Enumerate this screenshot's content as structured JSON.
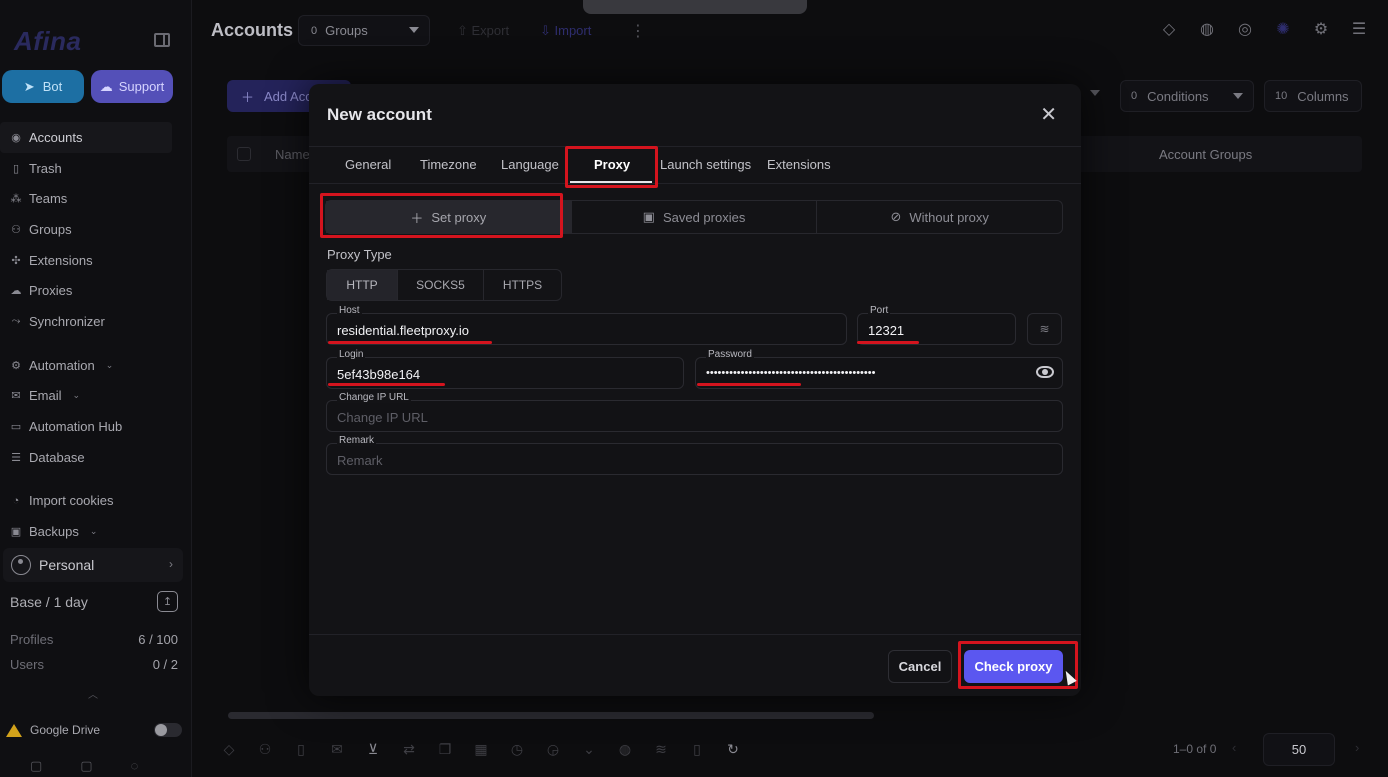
{
  "app": {
    "logo_text": "Afina",
    "sidebar_buttons": {
      "bot": "Bot",
      "support": "Support"
    },
    "nav": [
      {
        "label": "Accounts",
        "icon": "user-circle-icon",
        "active": true
      },
      {
        "label": "Trash",
        "icon": "trash-icon"
      },
      {
        "label": "Teams",
        "icon": "team-icon"
      },
      {
        "label": "Groups",
        "icon": "users-icon"
      },
      {
        "label": "Extensions",
        "icon": "puzzle-icon"
      },
      {
        "label": "Proxies",
        "icon": "cloud-icon"
      },
      {
        "label": "Synchronizer",
        "icon": "sync-icon"
      },
      {
        "label": "Automation",
        "icon": "automation-icon",
        "caret": true
      },
      {
        "label": "Email",
        "icon": "mail-icon",
        "caret": true
      },
      {
        "label": "Automation Hub",
        "icon": "laptop-icon"
      },
      {
        "label": "Database",
        "icon": "database-icon"
      },
      {
        "label": "Import cookies",
        "icon": "cookie-icon"
      },
      {
        "label": "Backups",
        "icon": "backup-icon",
        "caret": true
      }
    ],
    "workspace": {
      "name": "Personal"
    },
    "plan": {
      "label": "Base / 1 day"
    },
    "stats": [
      {
        "label": "Profiles",
        "value": "6 / 100"
      },
      {
        "label": "Users",
        "value": "0 / 2"
      }
    ],
    "google_drive": {
      "label": "Google Drive",
      "enabled": false
    }
  },
  "header": {
    "title": "Accounts",
    "groups_select": {
      "count": "0",
      "label": "Groups"
    },
    "export_label": "Export",
    "import_label": "Import",
    "right_icons": [
      "tag-icon",
      "fingerprint-icon",
      "globe-icon",
      "bug-icon",
      "gear-icon",
      "layers-icon"
    ]
  },
  "toolbar": {
    "add_account_label": "Add Acc",
    "conditions": {
      "count": "0",
      "label": "Conditions"
    },
    "columns": {
      "count": "10",
      "label": "Columns"
    }
  },
  "table": {
    "columns": [
      "Name",
      "Account Groups"
    ]
  },
  "pagination": {
    "range_text": "1–0 of 0",
    "page_size": "50"
  },
  "modal": {
    "title": "New account",
    "tabs": [
      "General",
      "Timezone",
      "Language",
      "Proxy",
      "Launch settings",
      "Extensions"
    ],
    "active_tab": "Proxy",
    "proxy_modes": [
      {
        "label": "Set proxy",
        "icon": "plus-icon",
        "active": true
      },
      {
        "label": "Saved proxies",
        "icon": "save-icon"
      },
      {
        "label": "Without proxy",
        "icon": "no-icon"
      }
    ],
    "proxy_type_label": "Proxy Type",
    "proxy_types": [
      "HTTP",
      "SOCKS5",
      "HTTPS"
    ],
    "active_proxy_type": "HTTP",
    "fields": {
      "host": {
        "label": "Host",
        "value": "residential.fleetproxy.io"
      },
      "port": {
        "label": "Port",
        "value": "12321"
      },
      "login": {
        "label": "Login",
        "value": "5ef43b98e164"
      },
      "password": {
        "label": "Password",
        "value": "••••••••••••••••••••••••••••••••••••••••••••"
      },
      "change_ip_url": {
        "label": "Change IP URL",
        "placeholder": "Change IP URL"
      },
      "remark": {
        "label": "Remark",
        "placeholder": "Remark"
      }
    },
    "buttons": {
      "cancel": "Cancel",
      "check_proxy": "Check proxy"
    },
    "highlight_color": "#d4141e",
    "accent_color": "#5b57f0"
  }
}
